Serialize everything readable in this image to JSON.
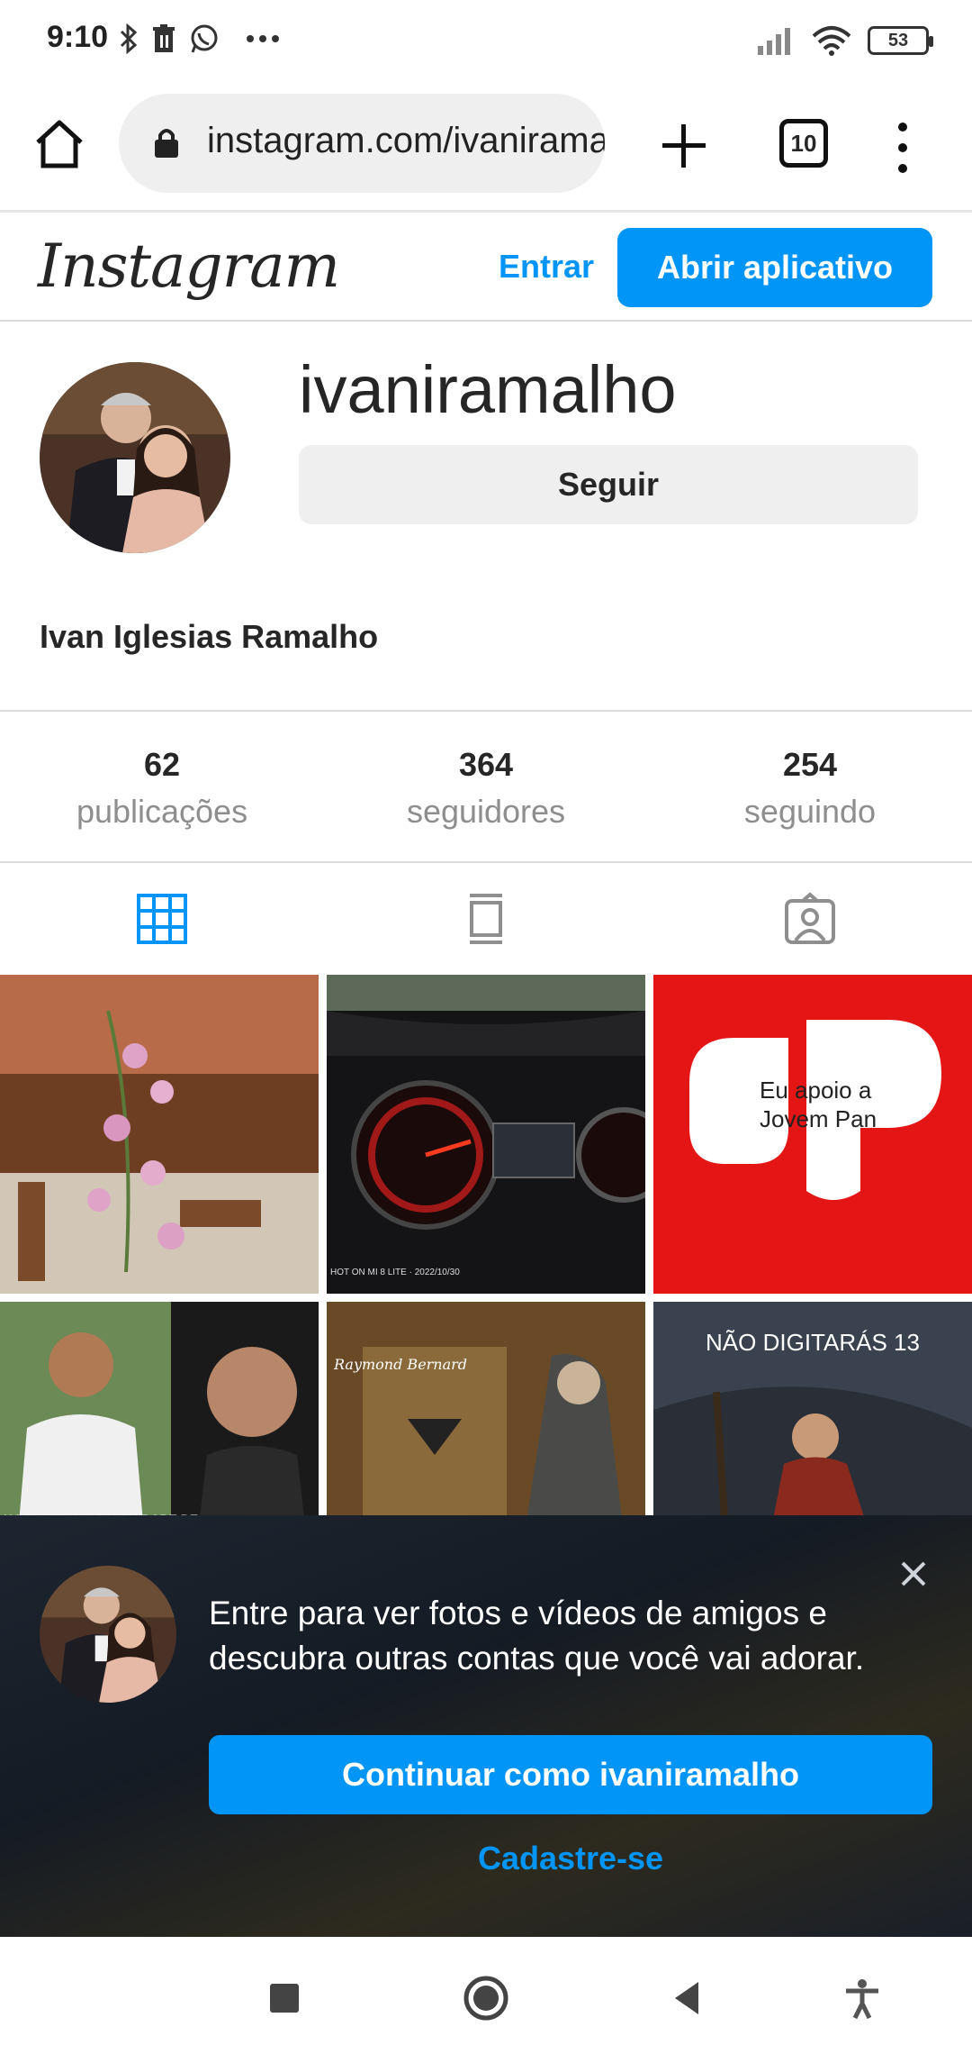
{
  "status_bar": {
    "time": "9:10",
    "battery": "53",
    "icons": [
      "bluetooth-icon",
      "trash-icon",
      "whatsapp-icon",
      "more-dots-icon",
      "signal-icon",
      "wifi-icon",
      "battery-icon"
    ]
  },
  "browser": {
    "url": "instagram.com/ivaniramalho",
    "tab_count": "10"
  },
  "ig_header": {
    "logo": "Instagram",
    "login_link": "Entrar",
    "open_app_button": "Abrir aplicativo",
    "brand_color": "#0095f6"
  },
  "profile": {
    "username": "ivaniramalho",
    "follow_button": "Seguir",
    "full_name": "Ivan Iglesias Ramalho",
    "stats": [
      {
        "value": "62",
        "label": "publicações"
      },
      {
        "value": "364",
        "label": "seguidores"
      },
      {
        "value": "254",
        "label": "seguindo"
      }
    ]
  },
  "grid_posts": [
    {
      "caption": ""
    },
    {
      "caption": "HOT ON MI 8 LITE · 2022/10/30"
    },
    {
      "caption": "Eu apoio a Jovem Pan"
    },
    {
      "caption": "HOJE SERIA A SOLENIDADE DE"
    },
    {
      "caption": "Raymond Bernard"
    },
    {
      "caption": "NÃO DIGITARÁS 13"
    }
  ],
  "overlay": {
    "message": "Entre para ver fotos e vídeos de amigos e descubra outras contas que você vai adorar.",
    "continue_button": "Continuar como ivaniramalho",
    "signup_link": "Cadastre-se"
  }
}
